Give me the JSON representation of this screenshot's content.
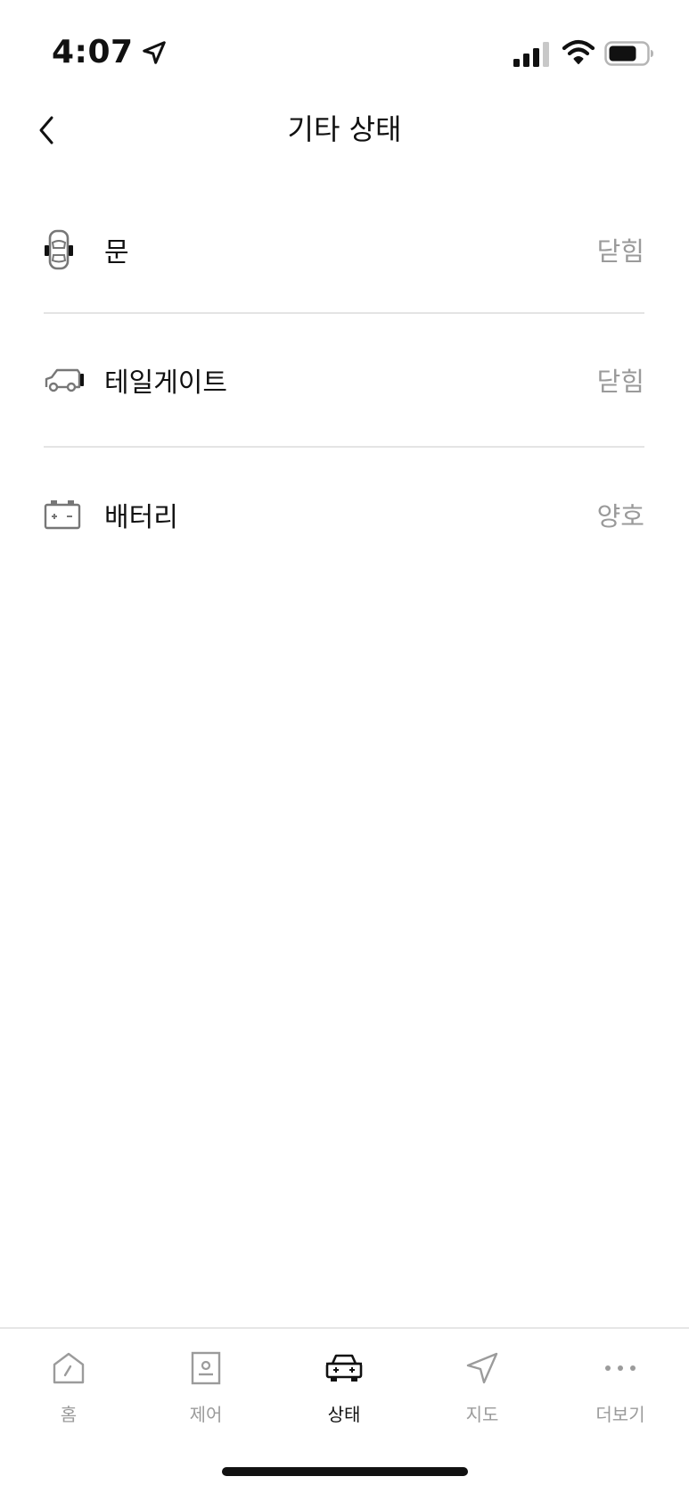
{
  "status_bar": {
    "time": "4:07"
  },
  "header": {
    "title": "기타 상태"
  },
  "items": [
    {
      "label": "문",
      "value": "닫힘",
      "icon": "door-icon"
    },
    {
      "label": "테일게이트",
      "value": "닫힘",
      "icon": "tailgate-icon"
    },
    {
      "label": "배터리",
      "value": "양호",
      "icon": "battery-icon"
    }
  ],
  "tabs": [
    {
      "label": "홈",
      "icon": "home-icon",
      "active": false
    },
    {
      "label": "제어",
      "icon": "control-icon",
      "active": false
    },
    {
      "label": "상태",
      "icon": "car-status-icon",
      "active": true
    },
    {
      "label": "지도",
      "icon": "navigation-icon",
      "active": false
    },
    {
      "label": "더보기",
      "icon": "more-icon",
      "active": false
    }
  ],
  "colors": {
    "text": "#111111",
    "muted": "#9a9a9a",
    "divider": "#e4e4e4"
  }
}
